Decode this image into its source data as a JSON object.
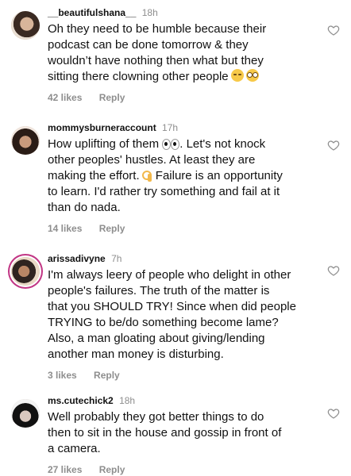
{
  "comments": [
    {
      "username": "__beautifulshana__",
      "time": "18h",
      "text": "Oh they need to be humble because their\npodcast can be done tomorrow & they\nwouldn’t have nothing then what but they\nsitting there clowning other people",
      "emojis": [
        "unamused-face-emoji",
        "flushed-face-emoji"
      ],
      "likes": "42 likes",
      "reply": "Reply"
    },
    {
      "username": "mommysburneraccount",
      "time": "17h",
      "text_part1": "How uplifting of them",
      "text_part2": ". Let's not knock\nother peoples' hustles. At least they are\nmaking the effort.",
      "text_part3": " Failure is an opportunity\nto learn. I'd rather try something and fail at it\nthan do nada.",
      "emojis": [
        "eyes-emoji",
        "ok-hand-emoji"
      ],
      "likes": "14 likes",
      "reply": "Reply"
    },
    {
      "username": "arissadivyne",
      "time": "7h",
      "text": "I'm always leery of people who delight in other\npeople's failures. The truth of the matter is\nthat you SHOULD TRY! Since when did people\nTRYING to be/do something become lame?\nAlso, a man gloating about giving/lending\nanother man money is disturbing.",
      "likes": "3 likes",
      "reply": "Reply"
    },
    {
      "username": "ms.cutechick2",
      "time": "18h",
      "text": "Well probably they got better things to do\nthen to sit in the house and gossip in front of\na camera.",
      "likes": "27 likes",
      "reply": "Reply"
    }
  ],
  "icons": {
    "like": "heart-outline-icon"
  },
  "colors": {
    "text": "#111111",
    "secondary": "#8e8e8e",
    "story_ring": "#c13584"
  }
}
